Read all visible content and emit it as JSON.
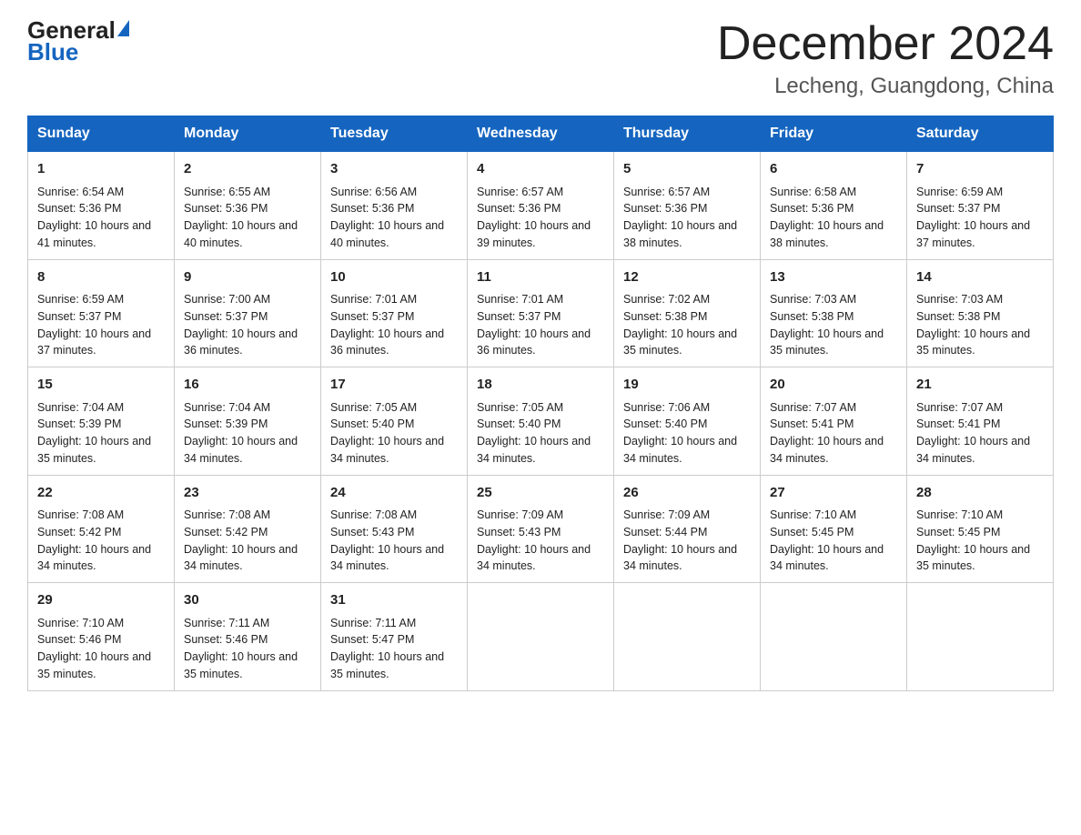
{
  "logo": {
    "general": "General",
    "blue": "Blue",
    "triangle": "▶"
  },
  "title": {
    "month_year": "December 2024",
    "location": "Lecheng, Guangdong, China"
  },
  "header_days": [
    "Sunday",
    "Monday",
    "Tuesday",
    "Wednesday",
    "Thursday",
    "Friday",
    "Saturday"
  ],
  "weeks": [
    [
      {
        "day": "1",
        "sunrise": "6:54 AM",
        "sunset": "5:36 PM",
        "daylight": "10 hours and 41 minutes."
      },
      {
        "day": "2",
        "sunrise": "6:55 AM",
        "sunset": "5:36 PM",
        "daylight": "10 hours and 40 minutes."
      },
      {
        "day": "3",
        "sunrise": "6:56 AM",
        "sunset": "5:36 PM",
        "daylight": "10 hours and 40 minutes."
      },
      {
        "day": "4",
        "sunrise": "6:57 AM",
        "sunset": "5:36 PM",
        "daylight": "10 hours and 39 minutes."
      },
      {
        "day": "5",
        "sunrise": "6:57 AM",
        "sunset": "5:36 PM",
        "daylight": "10 hours and 38 minutes."
      },
      {
        "day": "6",
        "sunrise": "6:58 AM",
        "sunset": "5:36 PM",
        "daylight": "10 hours and 38 minutes."
      },
      {
        "day": "7",
        "sunrise": "6:59 AM",
        "sunset": "5:37 PM",
        "daylight": "10 hours and 37 minutes."
      }
    ],
    [
      {
        "day": "8",
        "sunrise": "6:59 AM",
        "sunset": "5:37 PM",
        "daylight": "10 hours and 37 minutes."
      },
      {
        "day": "9",
        "sunrise": "7:00 AM",
        "sunset": "5:37 PM",
        "daylight": "10 hours and 36 minutes."
      },
      {
        "day": "10",
        "sunrise": "7:01 AM",
        "sunset": "5:37 PM",
        "daylight": "10 hours and 36 minutes."
      },
      {
        "day": "11",
        "sunrise": "7:01 AM",
        "sunset": "5:37 PM",
        "daylight": "10 hours and 36 minutes."
      },
      {
        "day": "12",
        "sunrise": "7:02 AM",
        "sunset": "5:38 PM",
        "daylight": "10 hours and 35 minutes."
      },
      {
        "day": "13",
        "sunrise": "7:03 AM",
        "sunset": "5:38 PM",
        "daylight": "10 hours and 35 minutes."
      },
      {
        "day": "14",
        "sunrise": "7:03 AM",
        "sunset": "5:38 PM",
        "daylight": "10 hours and 35 minutes."
      }
    ],
    [
      {
        "day": "15",
        "sunrise": "7:04 AM",
        "sunset": "5:39 PM",
        "daylight": "10 hours and 35 minutes."
      },
      {
        "day": "16",
        "sunrise": "7:04 AM",
        "sunset": "5:39 PM",
        "daylight": "10 hours and 34 minutes."
      },
      {
        "day": "17",
        "sunrise": "7:05 AM",
        "sunset": "5:40 PM",
        "daylight": "10 hours and 34 minutes."
      },
      {
        "day": "18",
        "sunrise": "7:05 AM",
        "sunset": "5:40 PM",
        "daylight": "10 hours and 34 minutes."
      },
      {
        "day": "19",
        "sunrise": "7:06 AM",
        "sunset": "5:40 PM",
        "daylight": "10 hours and 34 minutes."
      },
      {
        "day": "20",
        "sunrise": "7:07 AM",
        "sunset": "5:41 PM",
        "daylight": "10 hours and 34 minutes."
      },
      {
        "day": "21",
        "sunrise": "7:07 AM",
        "sunset": "5:41 PM",
        "daylight": "10 hours and 34 minutes."
      }
    ],
    [
      {
        "day": "22",
        "sunrise": "7:08 AM",
        "sunset": "5:42 PM",
        "daylight": "10 hours and 34 minutes."
      },
      {
        "day": "23",
        "sunrise": "7:08 AM",
        "sunset": "5:42 PM",
        "daylight": "10 hours and 34 minutes."
      },
      {
        "day": "24",
        "sunrise": "7:08 AM",
        "sunset": "5:43 PM",
        "daylight": "10 hours and 34 minutes."
      },
      {
        "day": "25",
        "sunrise": "7:09 AM",
        "sunset": "5:43 PM",
        "daylight": "10 hours and 34 minutes."
      },
      {
        "day": "26",
        "sunrise": "7:09 AM",
        "sunset": "5:44 PM",
        "daylight": "10 hours and 34 minutes."
      },
      {
        "day": "27",
        "sunrise": "7:10 AM",
        "sunset": "5:45 PM",
        "daylight": "10 hours and 34 minutes."
      },
      {
        "day": "28",
        "sunrise": "7:10 AM",
        "sunset": "5:45 PM",
        "daylight": "10 hours and 35 minutes."
      }
    ],
    [
      {
        "day": "29",
        "sunrise": "7:10 AM",
        "sunset": "5:46 PM",
        "daylight": "10 hours and 35 minutes."
      },
      {
        "day": "30",
        "sunrise": "7:11 AM",
        "sunset": "5:46 PM",
        "daylight": "10 hours and 35 minutes."
      },
      {
        "day": "31",
        "sunrise": "7:11 AM",
        "sunset": "5:47 PM",
        "daylight": "10 hours and 35 minutes."
      },
      null,
      null,
      null,
      null
    ]
  ]
}
